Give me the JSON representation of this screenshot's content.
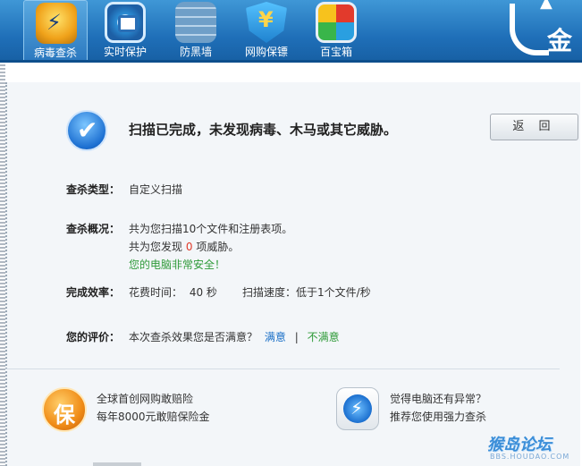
{
  "toolbar": {
    "items": [
      {
        "label": "病毒查杀",
        "icon": "virus-scan-icon",
        "active": true
      },
      {
        "label": "实时保护",
        "icon": "realtime-protect-icon",
        "active": false
      },
      {
        "label": "防黑墙",
        "icon": "firewall-icon",
        "active": false
      },
      {
        "label": "网购保镖",
        "icon": "shopping-guard-icon",
        "active": false
      },
      {
        "label": "百宝箱",
        "icon": "toolbox-icon",
        "active": false
      }
    ],
    "logo_text": "金山",
    "brand_color": "#1f6fb8"
  },
  "result": {
    "headline": "扫描已完成，未发现病毒、木马或其它威胁。",
    "back_label": "返 回"
  },
  "details": {
    "type_label": "查杀类型：",
    "type_value": "自定义扫描",
    "summary_label": "查杀概况：",
    "summary_line1": "共为您扫描10个文件和注册表项。",
    "summary_line2_prefix": "共为您发现",
    "summary_threat_count": "0",
    "summary_line2_suffix": "项威胁。",
    "summary_line3": "您的电脑非常安全！",
    "efficiency_label": "完成效率：",
    "time_label": "花费时间：",
    "time_value": "40 秒",
    "speed_label": "扫描速度：",
    "speed_value": "低于1个文件/秒",
    "rating_label": "您的评价：",
    "rating_question": "本次查杀效果您是否满意？",
    "rating_yes": "满意",
    "rating_sep": "|",
    "rating_no": "不满意"
  },
  "promos": {
    "left_line1": "全球首创网购敢赔险",
    "left_line2": "每年8000元敢赔保险金",
    "right_line1": "觉得电脑还有异常？",
    "right_line2": "推荐您使用强力查杀"
  },
  "watermark": {
    "text": "猴岛论坛",
    "sub": "BBS.HOUDAO.COM"
  }
}
